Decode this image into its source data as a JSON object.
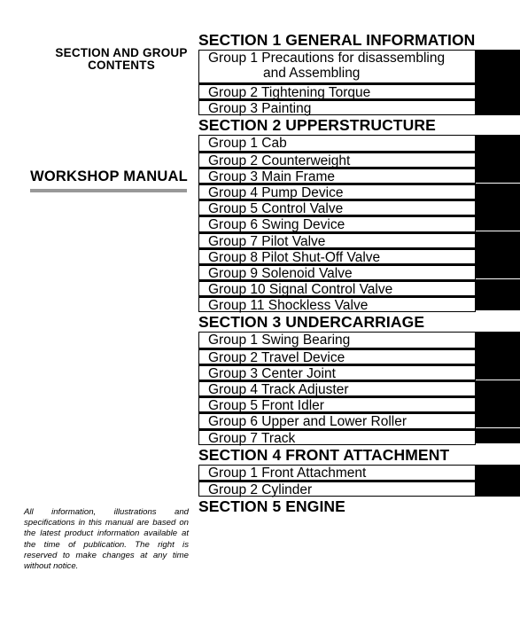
{
  "left_panel": {
    "contents_title_line1": "SECTION AND GROUP",
    "contents_title_line2": "CONTENTS",
    "manual_title": "WORKSHOP MANUAL",
    "disclaimer": "All information, illustrations and specifications in this manual are based on the latest product information available at the time of publication. The right is reserved to make changes at any time without notice."
  },
  "sections": [
    {
      "title": "SECTION 1 GENERAL INFORMATION",
      "groups": [
        {
          "label": "Group 1 Precautions for disassembling",
          "label_cont": "and Assembling"
        },
        {
          "label": "Group 2 Tightening Torque"
        },
        {
          "label": "Group 3 Painting"
        }
      ]
    },
    {
      "title": "SECTION 2 UPPERSTRUCTURE",
      "groups": [
        {
          "label": "Group 1 Cab"
        },
        {
          "label": "Group 2 Counterweight"
        },
        {
          "label": "Group 3 Main Frame"
        },
        {
          "label": "Group 4 Pump Device"
        },
        {
          "label": "Group 5 Control Valve"
        },
        {
          "label": "Group 6 Swing Device"
        },
        {
          "label": "Group 7 Pilot Valve"
        },
        {
          "label": "Group 8 Pilot Shut-Off Valve"
        },
        {
          "label": "Group 9 Solenoid Valve"
        },
        {
          "label": "Group 10 Signal Control Valve"
        },
        {
          "label": "Group 11 Shockless Valve"
        }
      ]
    },
    {
      "title": "SECTION 3 UNDERCARRIAGE",
      "groups": [
        {
          "label": "Group 1 Swing Bearing"
        },
        {
          "label": "Group 2 Travel Device"
        },
        {
          "label": "Group 3 Center Joint"
        },
        {
          "label": "Group 4 Track Adjuster"
        },
        {
          "label": "Group 5 Front Idler"
        },
        {
          "label": "Group 6 Upper and Lower Roller"
        },
        {
          "label": "Group 7 Track"
        }
      ]
    },
    {
      "title": "SECTION 4 FRONT ATTACHMENT",
      "groups": [
        {
          "label": "Group 1 Front Attachment"
        },
        {
          "label": "Group 2 Cylinder"
        }
      ]
    },
    {
      "title": "SECTION 5 ENGINE",
      "groups": []
    }
  ]
}
